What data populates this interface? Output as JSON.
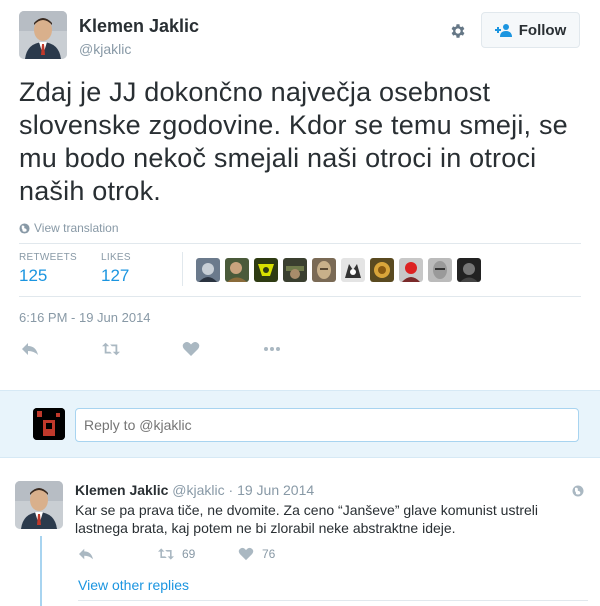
{
  "author": {
    "name": "Klemen Jaklic",
    "handle": "@kjaklic"
  },
  "follow_button": {
    "label": "Follow"
  },
  "tweet": {
    "text": "Zdaj je JJ dokončno največja osebnost slovenske zgodovine. Kdor se temu smeji, se mu bodo nekoč smejali naši otroci in otroci naših otrok.",
    "view_translation": "View translation",
    "retweets_label": "RETWEETS",
    "retweets_count": "125",
    "likes_label": "LIKES",
    "likes_count": "127",
    "timestamp": "6:16 PM - 19 Jun 2014"
  },
  "likers_count": 10,
  "reply_box": {
    "placeholder": "Reply to @kjaklic"
  },
  "reply_tweet": {
    "name": "Klemen Jaklic",
    "handle": "@kjaklic",
    "date": "· 19 Jun 2014",
    "text": "Kar se pa prava tiče, ne dvomite. Za ceno “Janševe” glave komunist ustreli lastnega brata, kaj potem ne bi zlorabil neke abstraktne ideje.",
    "retweets": "69",
    "likes": "76",
    "view_other_replies": "View other replies"
  },
  "colors": {
    "link": "#1b95e0",
    "muted": "#8899a6",
    "text": "#292f33",
    "reply_bar_bg": "#e8f4fb"
  },
  "icons": [
    "gear-icon",
    "follow-person-icon",
    "globe-icon",
    "reply-icon",
    "retweet-icon",
    "like-icon",
    "more-icon"
  ]
}
